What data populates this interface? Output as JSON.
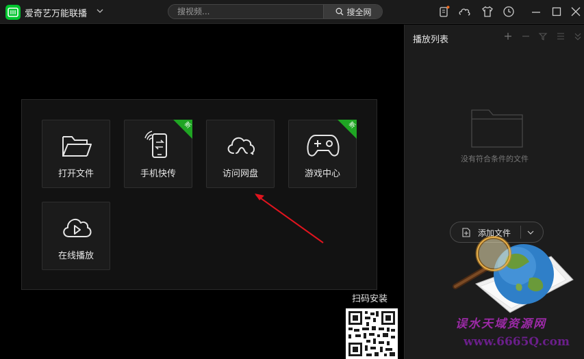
{
  "app": {
    "title": "爱奇艺万能联播"
  },
  "search": {
    "placeholder": "搜视频...",
    "button_label": "搜全网"
  },
  "titlebar": {
    "icons": [
      "phone-notify-icon",
      "cloud-icon",
      "skin-icon",
      "history-icon",
      "minimize-icon",
      "maximize-icon",
      "close-icon"
    ]
  },
  "tiles": [
    {
      "label": "打开文件",
      "icon": "folder-icon",
      "badge": ""
    },
    {
      "label": "手机快传",
      "icon": "phone-transfer-icon",
      "badge": "新"
    },
    {
      "label": "访问网盘",
      "icon": "cloud-drive-icon",
      "badge": ""
    },
    {
      "label": "游戏中心",
      "icon": "gamepad-icon",
      "badge": "新"
    },
    {
      "label": "在线播放",
      "icon": "cloud-play-icon",
      "badge": ""
    }
  ],
  "qr": {
    "label": "扫码安装"
  },
  "playlist": {
    "title": "播放列表",
    "empty_text": "没有符合条件的文件",
    "add_file_label": "添加文件",
    "tool_icons": [
      "add-icon",
      "remove-icon",
      "filter-icon",
      "list-icon",
      "collapse-icon"
    ]
  },
  "watermark": {
    "text": "误水天域资源网",
    "url": "www.6665Q.com"
  },
  "colors": {
    "accent": "#00c52f",
    "badge": "#1fa523",
    "annotation_arrow": "#e0141e"
  }
}
